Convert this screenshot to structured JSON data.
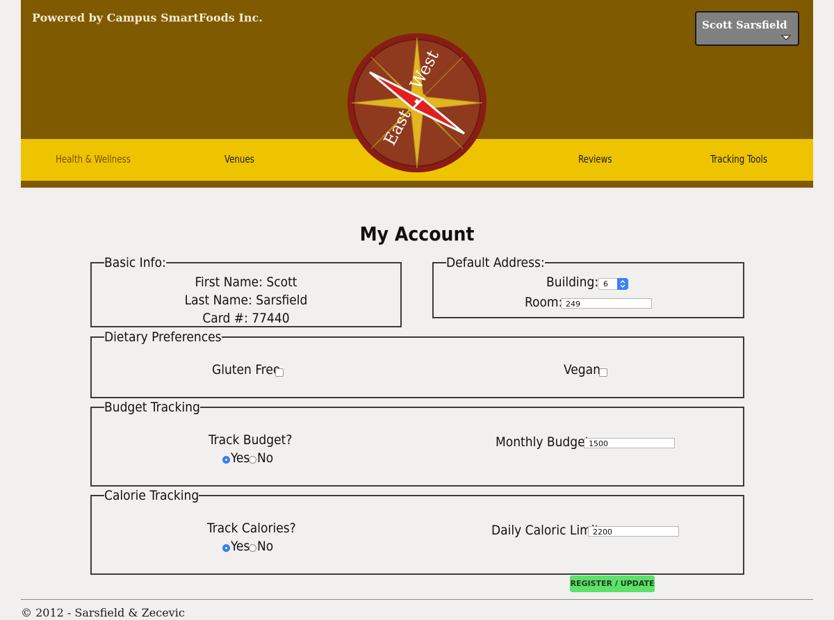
{
  "header": {
    "powered_by": "Powered by Campus SmartFoods Inc.",
    "user_menu": {
      "name": "Scott Sarsfield"
    },
    "logo": {
      "word_east": "East",
      "word_west": "West"
    }
  },
  "nav": {
    "items": [
      {
        "label": "Health & Wellness",
        "active": true
      },
      {
        "label": "Venues"
      },
      {
        "label": "Reviews"
      },
      {
        "label": "Tracking Tools"
      }
    ]
  },
  "page": {
    "title": "My Account"
  },
  "basic_info": {
    "legend": "Basic Info:",
    "first_name": "First Name: Scott",
    "last_name": "Last Name: Sarsfield",
    "card": "Card #: 77440"
  },
  "address": {
    "legend": "Default Address:",
    "building_label": "Building:",
    "building_value": "6",
    "room_label": "Room:",
    "room_value": "249"
  },
  "dietary": {
    "legend": "Dietary Preferences",
    "gluten_free_label": "Gluten Free",
    "gluten_free_checked": false,
    "vegan_label": "Vegan",
    "vegan_checked": false
  },
  "budget": {
    "legend": "Budget Tracking",
    "track_label": "Track Budget?",
    "yes_label": "Yes",
    "no_label": "No",
    "selected": "Yes",
    "monthly_label": "Monthly Budget",
    "monthly_value": "1500"
  },
  "calorie": {
    "legend": "Calorie Tracking",
    "track_label": "Track Calories?",
    "yes_label": "Yes",
    "no_label": "No",
    "selected": "Yes",
    "limit_label": "Daily Caloric Limit",
    "limit_value": "2200"
  },
  "actions": {
    "register_label": "REGISTER / UPDATE"
  },
  "footer": {
    "text": "© 2012 - Sarsfield & Zecevic"
  },
  "colors": {
    "header_brown": "#805a00",
    "nav_yellow": "#eec400",
    "button_green": "#5ee06a",
    "radio_blue": "#2f80ed"
  }
}
